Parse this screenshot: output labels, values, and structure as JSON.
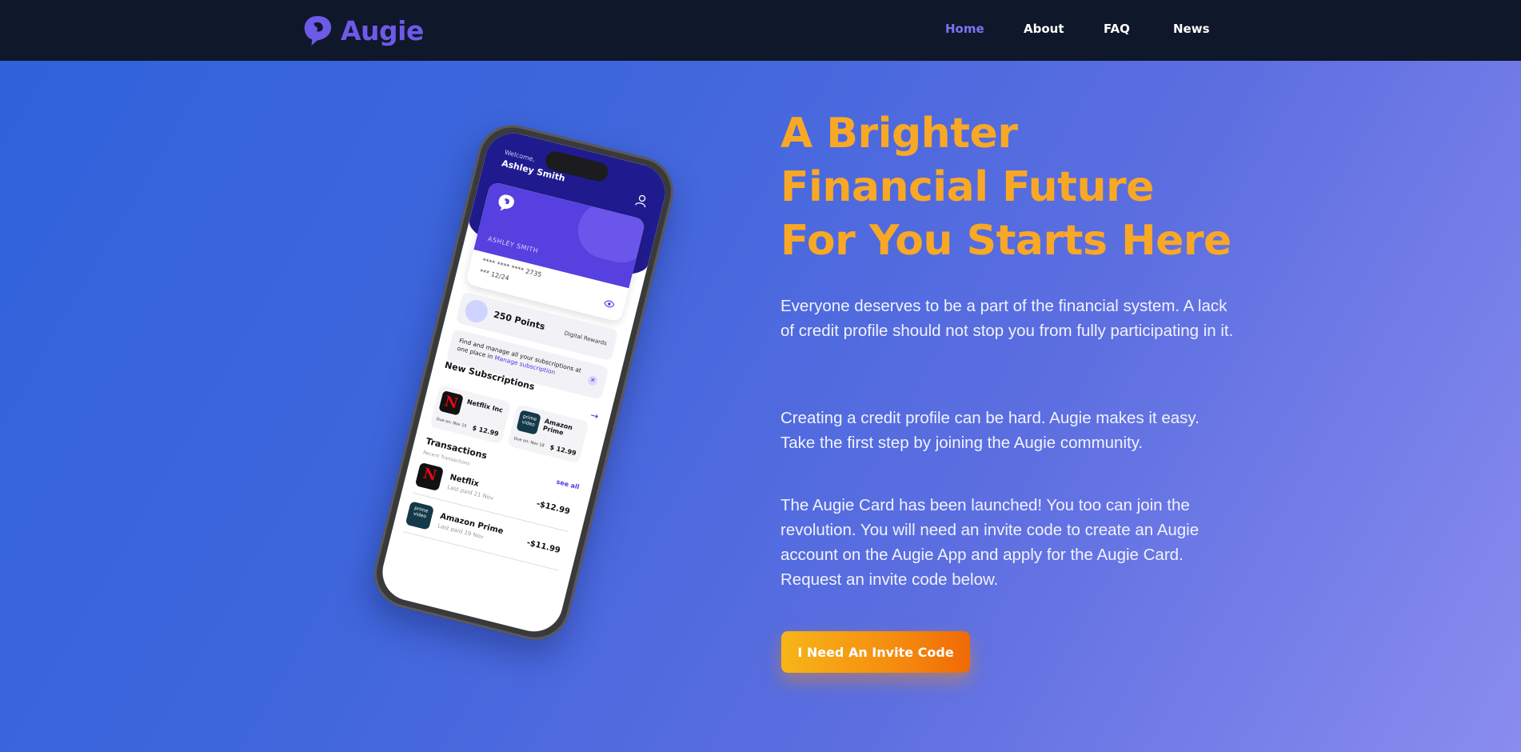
{
  "brand": {
    "name": "Augie",
    "accent": "#6d5ae8",
    "cta_color": "#f7a21b",
    "title_color": "#f9a825",
    "logo_icon": "augie-logo-icon"
  },
  "nav": {
    "items": [
      {
        "label": "Home",
        "active": true
      },
      {
        "label": "About",
        "active": false
      },
      {
        "label": "FAQ",
        "active": false
      },
      {
        "label": "News",
        "active": false
      }
    ]
  },
  "phone": {
    "welcome": "Welcome,",
    "user_name": "Ashley Smith",
    "card": {
      "holder": "ASHLEY SMITH",
      "number": "**** **** **** 2735",
      "expiry": "***   12/24"
    },
    "points": {
      "label": "250 Points",
      "rewards": "Digital Rewards"
    },
    "promo": {
      "text": "Find and manage all your subscriptions at one place in",
      "link": "Manage subscription"
    },
    "subscriptions_title": "New Subscriptions",
    "subscriptions": [
      {
        "name": "Netflix Inc",
        "due": "Due on: Nov 15",
        "price": "$ 12.99"
      },
      {
        "name": "Amazon Prime",
        "due": "Due on: Nov 18",
        "price": "$ 12.99"
      }
    ],
    "transactions_title": "Transactions",
    "recent_label": "Recent Transactions",
    "see_all": "see all",
    "transactions": [
      {
        "name": "Netflix",
        "date": "Last paid 21 Nov",
        "amount": "-$12.99"
      },
      {
        "name": "Amazon Prime",
        "date": "Last paid 19 Nov",
        "amount": "-$11.99"
      }
    ]
  },
  "hero": {
    "title_lines": [
      "A Brighter",
      "Financial Future",
      "For You Starts Here"
    ],
    "paragraphs": [
      "Everyone deserves to be a part of the financial system. A lack of credit profile should not stop you from fully participating in it.",
      "Creating a credit profile can be hard. Augie makes it easy. Take the first step by joining the Augie community.",
      "The Augie Card has been launched! You too can join the revolution. You will need an invite code to create an Augie account on the Augie App and apply for the Augie Card. Request an invite code below."
    ],
    "cta_label": "I Need An Invite Code"
  }
}
